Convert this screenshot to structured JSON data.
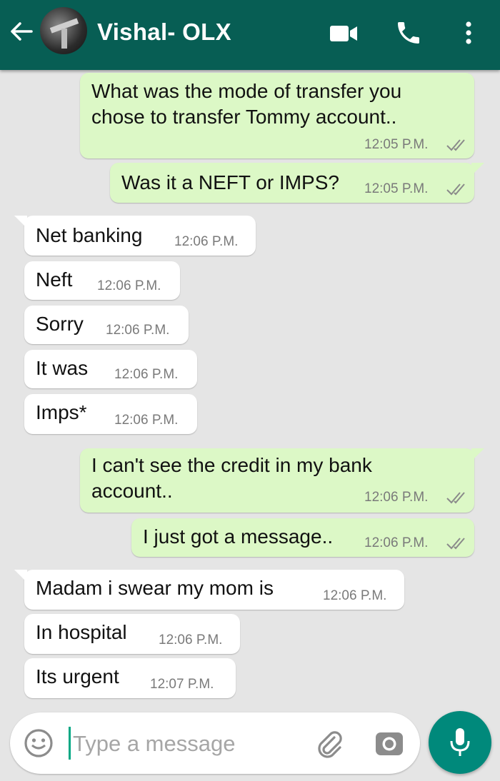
{
  "header": {
    "contact_name": "Vishal- OLX",
    "icons": {
      "back": "arrow-left-icon",
      "video": "video-camera-icon",
      "call": "phone-icon",
      "menu": "more-vert-icon"
    }
  },
  "colors": {
    "header": "#075e54",
    "outgoing_bubble": "#dcf8c6",
    "incoming_bubble": "#ffffff",
    "chat_background": "#e5e5e5",
    "mic_button": "#00897b"
  },
  "messages": [
    {
      "direction": "out",
      "lines": [
        "What was the mode of transfer you",
        "chose to transfer Tommy account.."
      ],
      "time": "12:05 P.M.",
      "status": "read"
    },
    {
      "direction": "out",
      "lines": [
        "Was it a NEFT or IMPS?"
      ],
      "time": "12:05 P.M.",
      "status": "read"
    },
    {
      "direction": "in",
      "lines": [
        "Net banking"
      ],
      "time": "12:06 P.M."
    },
    {
      "direction": "in",
      "lines": [
        "Neft"
      ],
      "time": "12:06 P.M."
    },
    {
      "direction": "in",
      "lines": [
        "Sorry"
      ],
      "time": "12:06 P.M."
    },
    {
      "direction": "in",
      "lines": [
        "It was"
      ],
      "time": "12:06 P.M."
    },
    {
      "direction": "in",
      "lines": [
        "Imps*"
      ],
      "time": "12:06 P.M."
    },
    {
      "direction": "out",
      "lines": [
        "I can't see the credit in my bank",
        "account.."
      ],
      "time": "12:06 P.M.",
      "status": "read"
    },
    {
      "direction": "out",
      "lines": [
        "I just got a message.."
      ],
      "time": "12:06 P.M.",
      "status": "read"
    },
    {
      "direction": "in",
      "lines": [
        "Madam i swear my mom is"
      ],
      "time": "12:06 P.M."
    },
    {
      "direction": "in",
      "lines": [
        "In hospital"
      ],
      "time": "12:06 P.M."
    },
    {
      "direction": "in",
      "lines": [
        "Its urgent"
      ],
      "time": "12:07 P.M."
    }
  ],
  "composer": {
    "placeholder": "Type a message",
    "value": "",
    "icons": {
      "emoji": "emoji-icon",
      "attach": "paperclip-icon",
      "camera": "camera-icon",
      "mic": "microphone-icon"
    }
  }
}
